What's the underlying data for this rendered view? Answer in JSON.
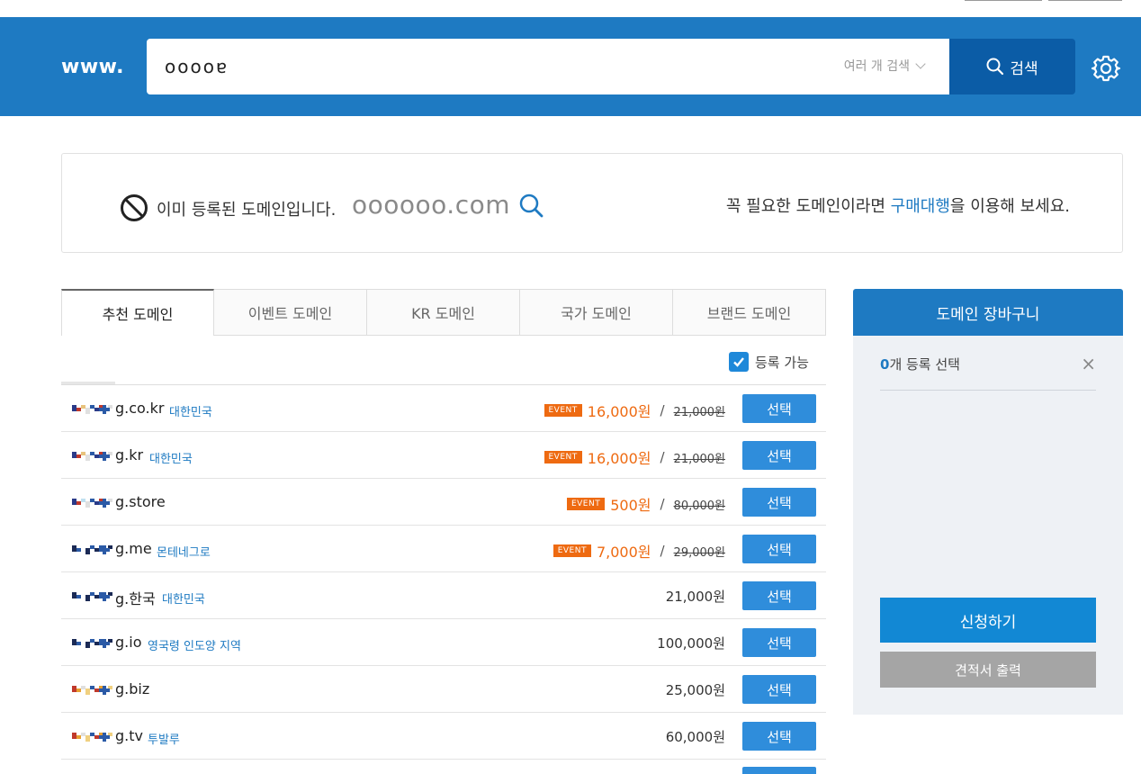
{
  "header": {
    "www_label": "www.",
    "search_value": "ooooɐ",
    "multi_search_label": "여러 개 검색",
    "search_button_label": "검색"
  },
  "notice": {
    "message": "이미 등록된 도메인입니다.",
    "domain": "oooooo.com",
    "right_prefix": "꼭 필요한 도메인이라면 ",
    "right_link": "구매대행",
    "right_suffix": "을 이용해 보세요."
  },
  "tabs": [
    {
      "label": "추천 도메인",
      "active": true
    },
    {
      "label": "이벤트 도메인"
    },
    {
      "label": "KR 도메인"
    },
    {
      "label": "국가 도메인"
    },
    {
      "label": "브랜드 도메인"
    }
  ],
  "filter": {
    "available_label": "등록 가능",
    "checked": true
  },
  "list": {
    "event_label": "EVENT",
    "select_label": "선택",
    "rows": [
      {
        "domain": "g.co.kr",
        "country": "대한민국",
        "event": true,
        "price": "16,000원",
        "orig_price": "21,000원"
      },
      {
        "domain": "g.kr",
        "country": "대한민국",
        "event": true,
        "price": "16,000원",
        "orig_price": "21,000원"
      },
      {
        "domain": "g.store",
        "country": "",
        "event": true,
        "price": "500원",
        "orig_price": "80,000원"
      },
      {
        "domain": "g.me",
        "country": "몬테네그로",
        "event": true,
        "price": "7,000원",
        "orig_price": "29,000원"
      },
      {
        "domain": "g.한국",
        "country": "대한민국",
        "event": false,
        "price": "21,000원"
      },
      {
        "domain": "g.io",
        "country": "영국령 인도양 지역",
        "event": false,
        "price": "100,000원"
      },
      {
        "domain": "g.biz",
        "country": "",
        "event": false,
        "price": "25,000원"
      },
      {
        "domain": "g.tv",
        "country": "투발루",
        "event": false,
        "price": "60,000원"
      }
    ]
  },
  "cart": {
    "title": "도메인 장바구니",
    "count": "0",
    "count_suffix": "개 등록 선택",
    "close_icon": "×",
    "apply_label": "신청하기",
    "quote_label": "견적서 출력"
  },
  "colors": {
    "brand_blue": "#1e7ac2",
    "search_button": "#0b5ca6",
    "select_button": "#2f8ddb",
    "event_orange": "#ee6a11"
  }
}
